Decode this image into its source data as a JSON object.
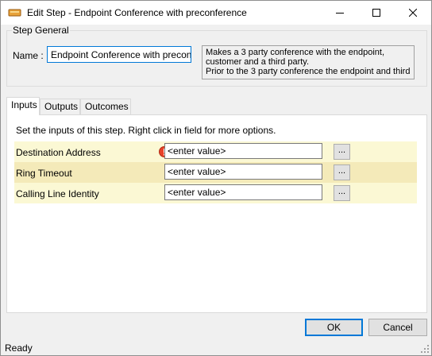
{
  "window": {
    "title": "Edit Step - Endpoint Conference with preconference",
    "icon": "step-icon",
    "controls": {
      "minimize": "minimize-icon",
      "maximize": "maximize-icon",
      "close": "close-icon"
    }
  },
  "step_general": {
    "legend": "Step General",
    "name_label": "Name :",
    "name_value": "Endpoint Conference with preconference",
    "description_lines": [
      "Makes a 3 party conference with the endpoint,",
      "customer and a third party.",
      "Prior to the 3 party conference the endpoint and third"
    ]
  },
  "tabs": [
    {
      "label": "Inputs",
      "active": true
    },
    {
      "label": "Outputs",
      "active": false
    },
    {
      "label": "Outcomes",
      "active": false
    }
  ],
  "inputs_panel": {
    "instructions": "Set the inputs of this step.  Right click in field for more options.",
    "rows": [
      {
        "label": "Destination Address",
        "value": "<enter value>",
        "button": "...",
        "has_error": true,
        "bg": "#fbf8d4"
      },
      {
        "label": "Ring Timeout",
        "value": "<enter value>",
        "button": "...",
        "has_error": false,
        "bg": "#f4eab9"
      },
      {
        "label": "Calling Line Identity",
        "value": "<enter value>",
        "button": "...",
        "has_error": false,
        "bg": "#fbf8d4"
      }
    ]
  },
  "buttons": {
    "ok": "OK",
    "cancel": "Cancel"
  },
  "status": {
    "text": "Ready"
  },
  "colors": {
    "accent": "#0078d7",
    "error": "#e8432a"
  }
}
